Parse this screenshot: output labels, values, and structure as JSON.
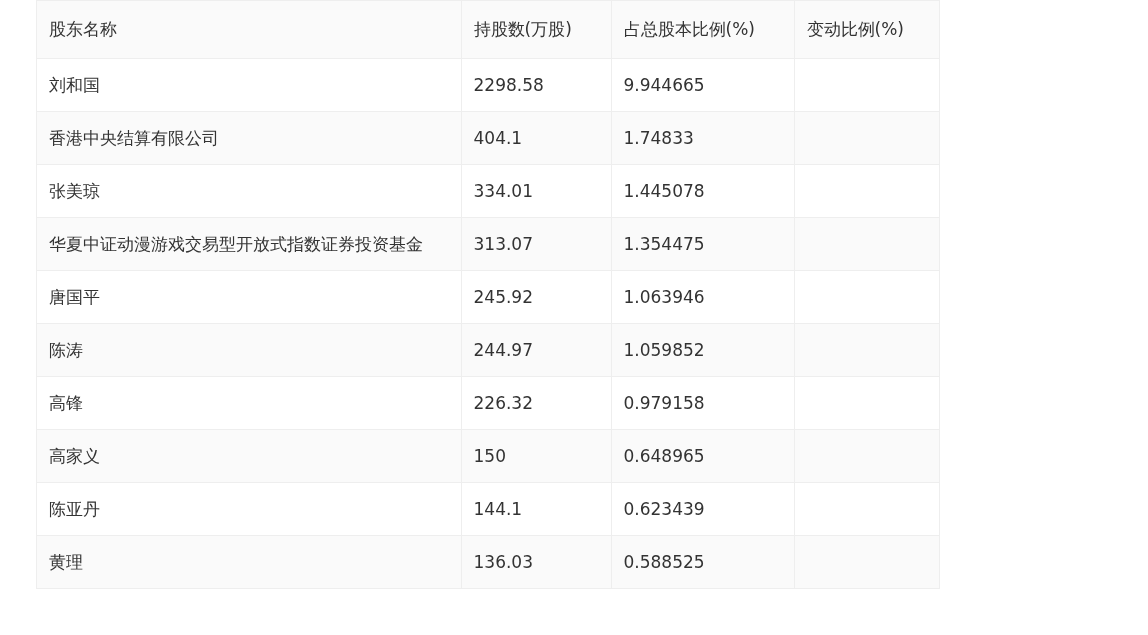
{
  "table": {
    "columns": [
      "股东名称",
      "持股数(万股)",
      "占总股本比例(%)",
      "变动比例(%)"
    ],
    "rows": [
      {
        "name": "刘和国",
        "shares": "2298.58",
        "ratio": "9.944665"
      },
      {
        "name": "香港中央结算有限公司",
        "shares": "404.1",
        "ratio": "1.74833"
      },
      {
        "name": "张美琼",
        "shares": "334.01",
        "ratio": "1.445078"
      },
      {
        "name": "华夏中证动漫游戏交易型开放式指数证券投资基金",
        "shares": "313.07",
        "ratio": "1.354475"
      },
      {
        "name": "唐国平",
        "shares": "245.92",
        "ratio": "1.063946"
      },
      {
        "name": "陈涛",
        "shares": "244.97",
        "ratio": "1.059852"
      },
      {
        "name": "高锋",
        "shares": "226.32",
        "ratio": "0.979158"
      },
      {
        "name": "高家义",
        "shares": "150",
        "ratio": "0.648965"
      },
      {
        "name": "陈亚丹",
        "shares": "144.1",
        "ratio": "0.623439"
      },
      {
        "name": "黄理",
        "shares": "136.03",
        "ratio": "0.588525"
      }
    ]
  }
}
